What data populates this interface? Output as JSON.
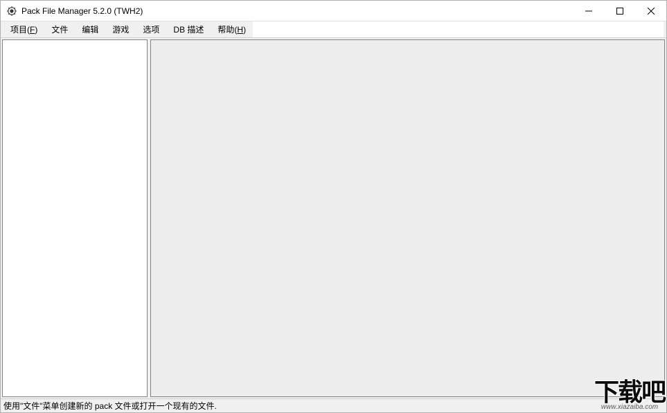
{
  "window": {
    "title": "Pack File Manager 5.2.0 (TWH2)"
  },
  "menubar": {
    "items": [
      {
        "label": "项目(",
        "hotkey": "F",
        "suffix": ")"
      },
      {
        "label": "文件",
        "hotkey": "",
        "suffix": ""
      },
      {
        "label": "编辑",
        "hotkey": "",
        "suffix": ""
      },
      {
        "label": "游戏",
        "hotkey": "",
        "suffix": ""
      },
      {
        "label": "选项",
        "hotkey": "",
        "suffix": ""
      },
      {
        "label": "DB 描述",
        "hotkey": "",
        "suffix": ""
      },
      {
        "label": "帮助(",
        "hotkey": "H",
        "suffix": ")"
      }
    ]
  },
  "statusbar": {
    "text": "使用\"文件\"菜单创建新的 pack 文件或打开一个现有的文件."
  },
  "watermark": {
    "main": "下载吧",
    "sub": "www.xiazaiba.com"
  }
}
